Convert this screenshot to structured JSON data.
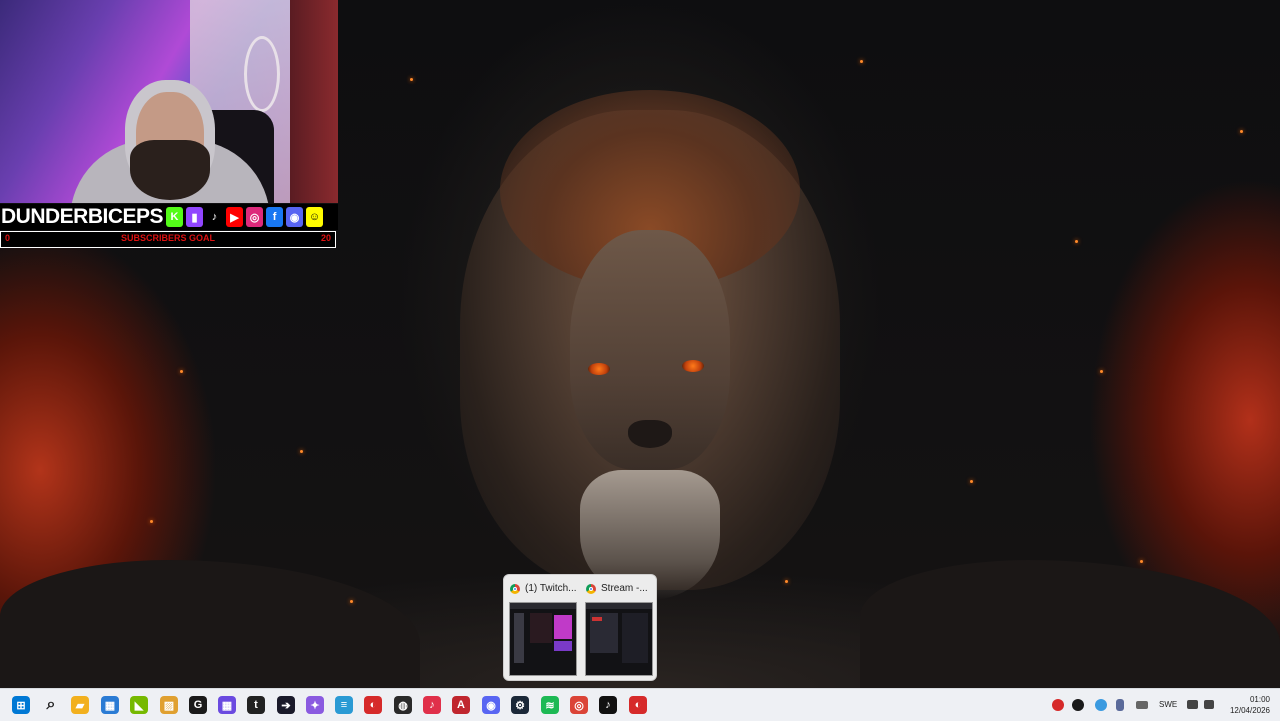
{
  "overlay": {
    "channel_name": "DUNDERBICEPS",
    "social_icons": [
      {
        "name": "kick-icon",
        "glyph": "K",
        "color": "#53fc18"
      },
      {
        "name": "twitch-icon",
        "glyph": "▮",
        "color": "#9146ff"
      },
      {
        "name": "tiktok-icon",
        "glyph": "♪",
        "color": "#000000"
      },
      {
        "name": "youtube-icon",
        "glyph": "▶",
        "color": "#ff0000"
      },
      {
        "name": "instagram-icon",
        "glyph": "◎",
        "color": "#dd2a7b"
      },
      {
        "name": "facebook-icon",
        "glyph": "f",
        "color": "#1877f2"
      },
      {
        "name": "discord-icon",
        "glyph": "◉",
        "color": "#5865f2"
      },
      {
        "name": "snapchat-icon",
        "glyph": "☺",
        "color": "#fffc00"
      }
    ],
    "goal_label": "SUBSCRIBERS GOAL",
    "goal_current": "0",
    "goal_target": "20"
  },
  "preview": {
    "windows": [
      {
        "title": "(1) Twitch..."
      },
      {
        "title": "Stream -..."
      }
    ]
  },
  "taskbar": {
    "apps": [
      {
        "name": "start-windows-icon",
        "glyph": "⊞",
        "color": "#0078d4"
      },
      {
        "name": "search-icon",
        "glyph": "⌕",
        "color": "#333333"
      },
      {
        "name": "file-explorer-icon",
        "glyph": "▰",
        "color": "#f2b01e"
      },
      {
        "name": "microsoft-store-icon",
        "glyph": "▦",
        "color": "#2a7bd4"
      },
      {
        "name": "nvidia-icon",
        "glyph": "◣",
        "color": "#76b900"
      },
      {
        "name": "photos-icon",
        "glyph": "▨",
        "color": "#e0a030"
      },
      {
        "name": "g-hub-icon",
        "glyph": "G",
        "color": "#1a1a1a"
      },
      {
        "name": "app-grid-icon",
        "glyph": "▦",
        "color": "#6a4ae0"
      },
      {
        "name": "tpm-icon",
        "glyph": "t",
        "color": "#222222"
      },
      {
        "name": "arrow-app-icon",
        "glyph": "➔",
        "color": "#1a1a2a"
      },
      {
        "name": "copilot-icon",
        "glyph": "✦",
        "color": "#8a5ae0"
      },
      {
        "name": "notes-icon",
        "glyph": "≡",
        "color": "#2a9ad4"
      },
      {
        "name": "streamelements-icon",
        "glyph": "◐",
        "color": "#d62a2a"
      },
      {
        "name": "obs-icon",
        "glyph": "◍",
        "color": "#2a2a2a"
      },
      {
        "name": "tiktok-live-icon",
        "glyph": "♪",
        "color": "#e0304a"
      },
      {
        "name": "adobe-icon",
        "glyph": "A",
        "color": "#c0262e"
      },
      {
        "name": "discord-icon",
        "glyph": "◉",
        "color": "#5865f2"
      },
      {
        "name": "steam-icon",
        "glyph": "⚙",
        "color": "#1b2838"
      },
      {
        "name": "spotify-icon",
        "glyph": "≋",
        "color": "#1db954"
      },
      {
        "name": "chrome-icon",
        "glyph": "◎",
        "color": "#db4437"
      },
      {
        "name": "tiktok-icon",
        "glyph": "♪",
        "color": "#111111"
      },
      {
        "name": "streamlabs-icon",
        "glyph": "◐",
        "color": "#d62a2a"
      }
    ],
    "tray": {
      "language": "SWE",
      "time": "01:00",
      "date": "12/04/2026"
    }
  }
}
